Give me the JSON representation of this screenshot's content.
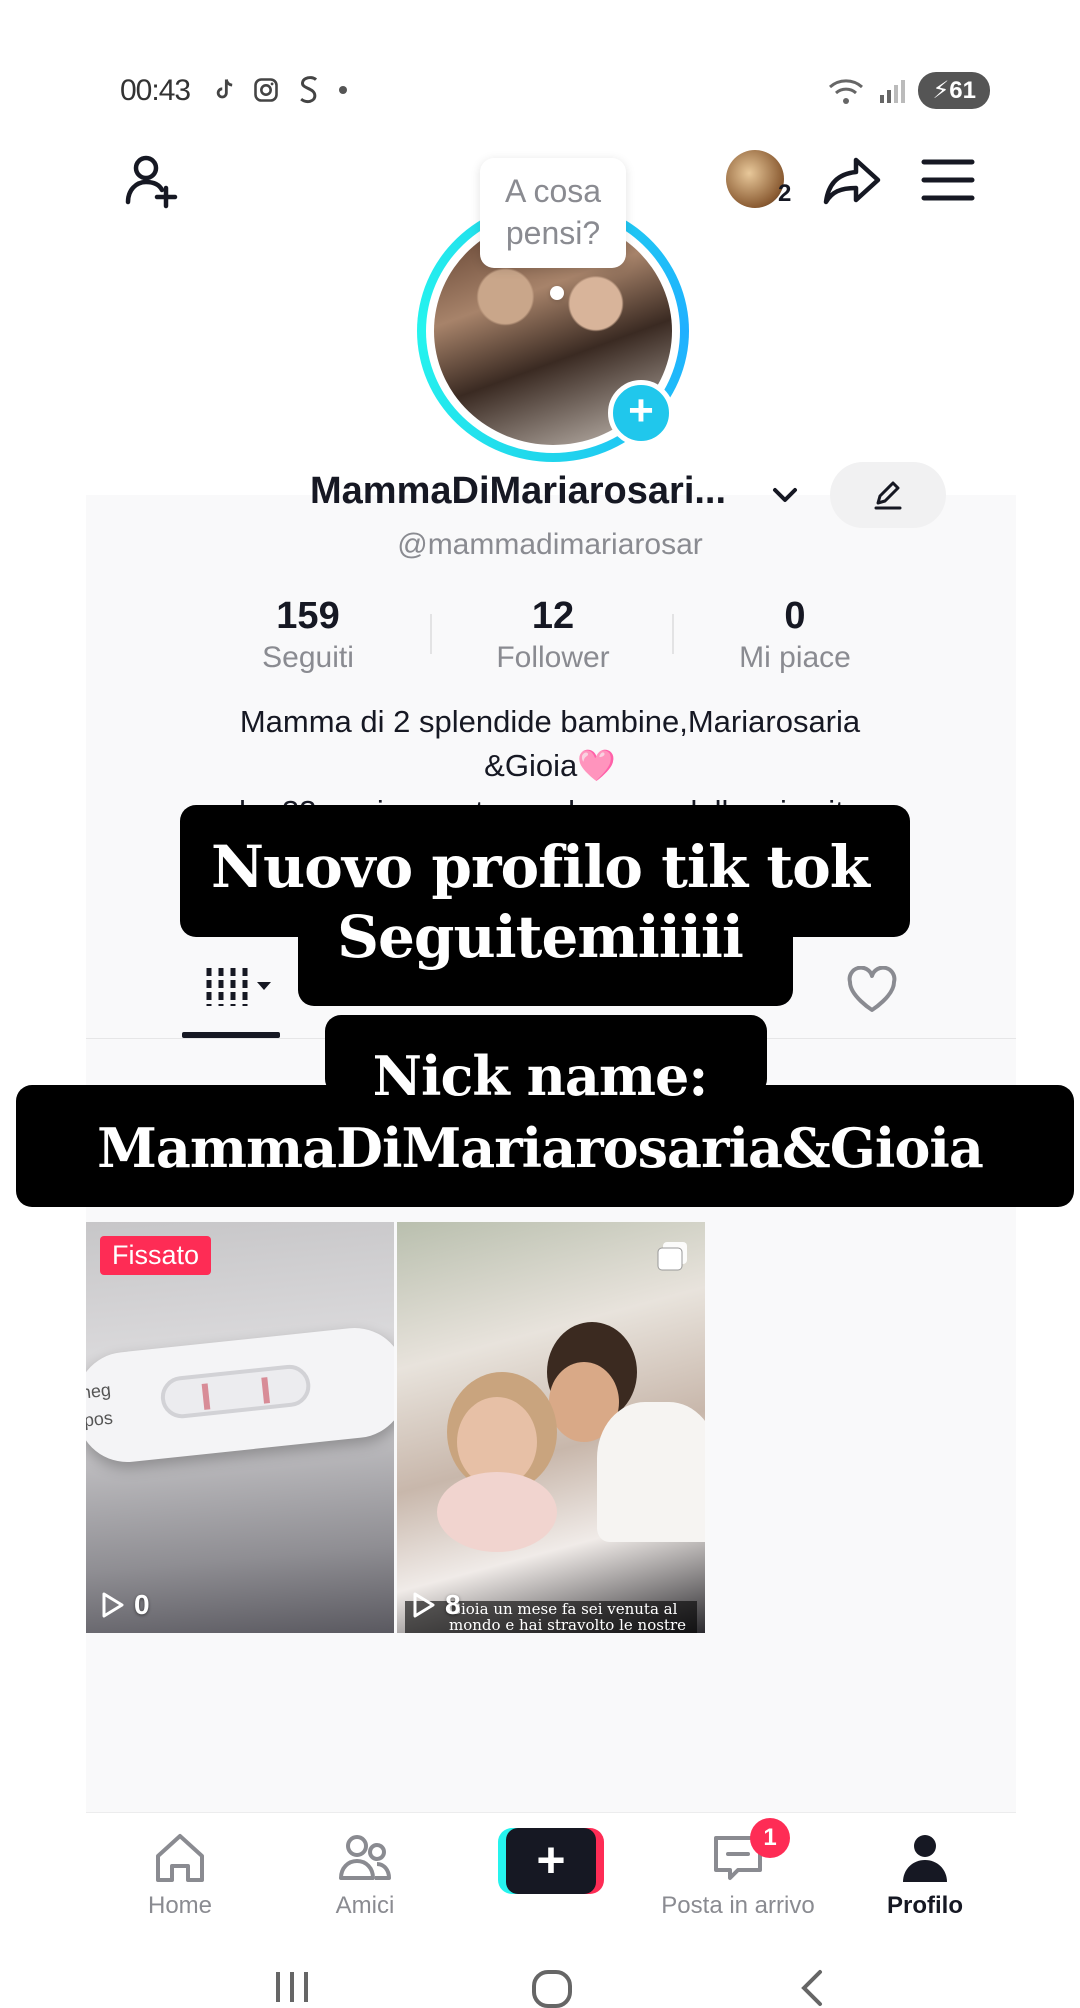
{
  "status_bar": {
    "time": "00:43",
    "app_icons": [
      "tiktok-icon",
      "instagram-icon",
      "s-icon",
      "dot-icon"
    ],
    "battery": "61"
  },
  "top_nav": {
    "follower_requests_count": "2"
  },
  "profile": {
    "thought_bubble": "A cosa\npensi?",
    "display_name": "MammaDiMariarosari...",
    "username": "@mammadimariarosar",
    "stats": [
      {
        "value": "159",
        "label": "Seguiti"
      },
      {
        "value": "12",
        "label": "Follower"
      },
      {
        "value": "0",
        "label": "Mi piace"
      }
    ],
    "bio_line1": "Mamma di 2 splendide bambine,Mariarosaria",
    "bio_line2": "&Gioia🩷",
    "bio_line3": "ho 33 anni sposata con l amore della mia vita"
  },
  "overlay": {
    "caption1": "Nuovo profilo tik tok\nSeguitemiiiii",
    "caption2": "Nick name:\nMammaDiMariarosaria&Gioia"
  },
  "videos": [
    {
      "badge": "Fissato",
      "plays": "0",
      "strip_labels": [
        "neg",
        "pos"
      ]
    },
    {
      "plays": "8",
      "caption": "Gioia un mese fa sei venuta al mondo e hai stravolto le nostre vite, ti abbiamo"
    }
  ],
  "bottom_nav": {
    "items": [
      {
        "label": "Home"
      },
      {
        "label": "Amici"
      },
      {
        "label": "Posta in arrivo",
        "badge": "1"
      },
      {
        "label": "Profilo"
      }
    ]
  },
  "colors": {
    "accent_red": "#fe2c55",
    "accent_cyan": "#25f4ee",
    "text_primary": "#161823",
    "text_secondary": "#8a8b91"
  }
}
